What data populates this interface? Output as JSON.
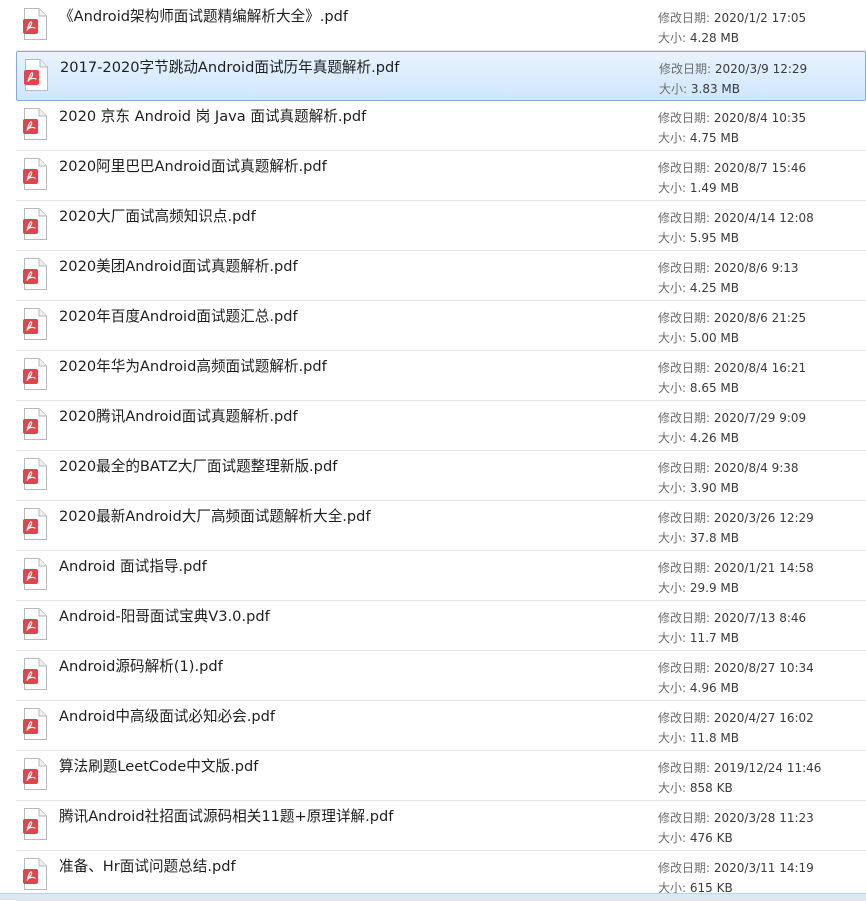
{
  "labels": {
    "modified": "修改日期:",
    "size": "大小:"
  },
  "selected_index": 1,
  "files": [
    {
      "name": "《Android架构师面试题精编解析大全》.pdf",
      "modified": "2020/1/2 17:05",
      "size": "4.28 MB"
    },
    {
      "name": "2017-2020字节跳动Android面试历年真题解析.pdf",
      "modified": "2020/3/9 12:29",
      "size": "3.83 MB"
    },
    {
      "name": "2020 京东 Android 岗 Java 面试真题解析.pdf",
      "modified": "2020/8/4 10:35",
      "size": "4.75 MB"
    },
    {
      "name": "2020阿里巴巴Android面试真题解析.pdf",
      "modified": "2020/8/7 15:46",
      "size": "1.49 MB"
    },
    {
      "name": "2020大厂面试高频知识点.pdf",
      "modified": "2020/4/14 12:08",
      "size": "5.95 MB"
    },
    {
      "name": "2020美团Android面试真题解析.pdf",
      "modified": "2020/8/6 9:13",
      "size": "4.25 MB"
    },
    {
      "name": "2020年百度Android面试题汇总.pdf",
      "modified": "2020/8/6 21:25",
      "size": "5.00 MB"
    },
    {
      "name": "2020年华为Android高频面试题解析.pdf",
      "modified": "2020/8/4 16:21",
      "size": "8.65 MB"
    },
    {
      "name": "2020腾讯Android面试真题解析.pdf",
      "modified": "2020/7/29 9:09",
      "size": "4.26 MB"
    },
    {
      "name": "2020最全的BATZ大厂面试题整理新版.pdf",
      "modified": "2020/8/4 9:38",
      "size": "3.90 MB"
    },
    {
      "name": "2020最新Android大厂高频面试题解析大全.pdf",
      "modified": "2020/3/26 12:29",
      "size": "37.8 MB"
    },
    {
      "name": "Android 面试指导.pdf",
      "modified": "2020/1/21 14:58",
      "size": "29.9 MB"
    },
    {
      "name": "Android-阳哥面试宝典V3.0.pdf",
      "modified": "2020/7/13 8:46",
      "size": "11.7 MB"
    },
    {
      "name": "Android源码解析(1).pdf",
      "modified": "2020/8/27 10:34",
      "size": "4.96 MB"
    },
    {
      "name": "Android中高级面试必知必会.pdf",
      "modified": "2020/4/27 16:02",
      "size": "11.8 MB"
    },
    {
      "name": "算法刷题LeetCode中文版.pdf",
      "modified": "2019/12/24 11:46",
      "size": "858 KB"
    },
    {
      "name": "腾讯Android社招面试源码相关11题+原理详解.pdf",
      "modified": "2020/3/28 11:23",
      "size": "476 KB"
    },
    {
      "name": "准备、Hr面试问题总结.pdf",
      "modified": "2020/3/11 14:19",
      "size": "615 KB"
    }
  ],
  "icon": {
    "name": "pdf-file-icon",
    "badge_color": "#e0454b",
    "page_color": "#ffffff",
    "border_color": "#b9b9b9"
  }
}
